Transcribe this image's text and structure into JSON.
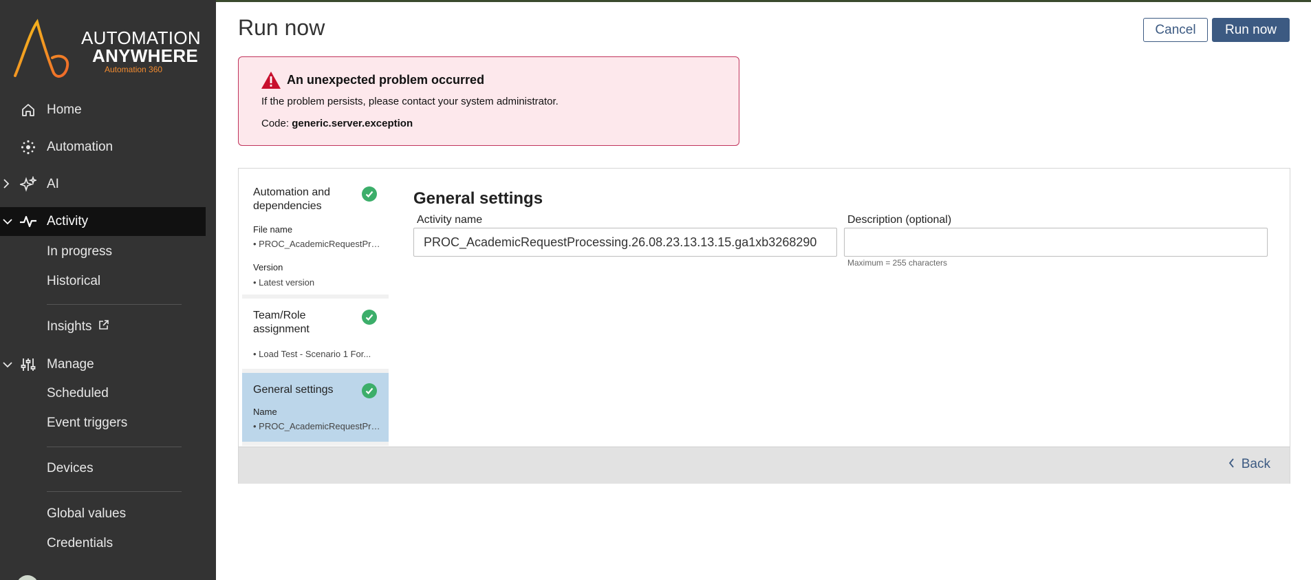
{
  "sidebar": {
    "logo": {
      "line1": "AUTOMATION",
      "line2": "ANYWHERE",
      "line3": "Automation 360"
    },
    "items": [
      {
        "label": "Home",
        "icon": "home-icon"
      },
      {
        "label": "Automation",
        "icon": "automation-icon"
      },
      {
        "label": "AI",
        "icon": "ai-sparkle-icon"
      },
      {
        "label": "Activity",
        "icon": "activity-pulse-icon"
      },
      {
        "label": "Manage",
        "icon": "sliders-icon"
      }
    ],
    "activity_sub": [
      "In progress",
      "Historical"
    ],
    "insights_label": "Insights",
    "manage_sub": [
      "Scheduled",
      "Event triggers"
    ],
    "devices_label": "Devices",
    "other_sub": [
      "Global values",
      "Credentials"
    ]
  },
  "header": {
    "title": "Run now",
    "cancel_label": "Cancel",
    "run_label": "Run now"
  },
  "alert": {
    "title": "An unexpected problem occurred",
    "message": "If the problem persists, please contact your system administrator.",
    "code_label": "Code:",
    "code_value": "generic.server.exception"
  },
  "steps": [
    {
      "title": "Automation and dependencies",
      "fields": [
        {
          "label": "File name",
          "value": "• PROC_AcademicRequestProcessing"
        },
        {
          "label": "Version",
          "value": "• Latest version"
        }
      ]
    },
    {
      "title": "Team/Role assignment",
      "fields": [
        {
          "label": "",
          "value": "• Load Test - Scenario 1 For..."
        }
      ]
    },
    {
      "title": "General settings",
      "fields": [
        {
          "label": "Name",
          "value": "• PROC_AcademicRequestProcessing"
        }
      ]
    }
  ],
  "general": {
    "title": "General settings",
    "activity_name_label": "Activity name",
    "activity_name_value": "PROC_AcademicRequestProcessing.26.08.23.13.13.15.ga1xb3268290",
    "description_label": "Description (optional)",
    "description_value": "",
    "description_hint": "Maximum = 255 characters"
  },
  "footer": {
    "back_label": "Back"
  },
  "colors": {
    "accent": "#3c5a82",
    "sidebar": "#333333",
    "alert_bg": "#fde8ec",
    "alert_border": "#c0335b",
    "success": "#3cae6a",
    "selected_step": "#bcd6ea"
  }
}
